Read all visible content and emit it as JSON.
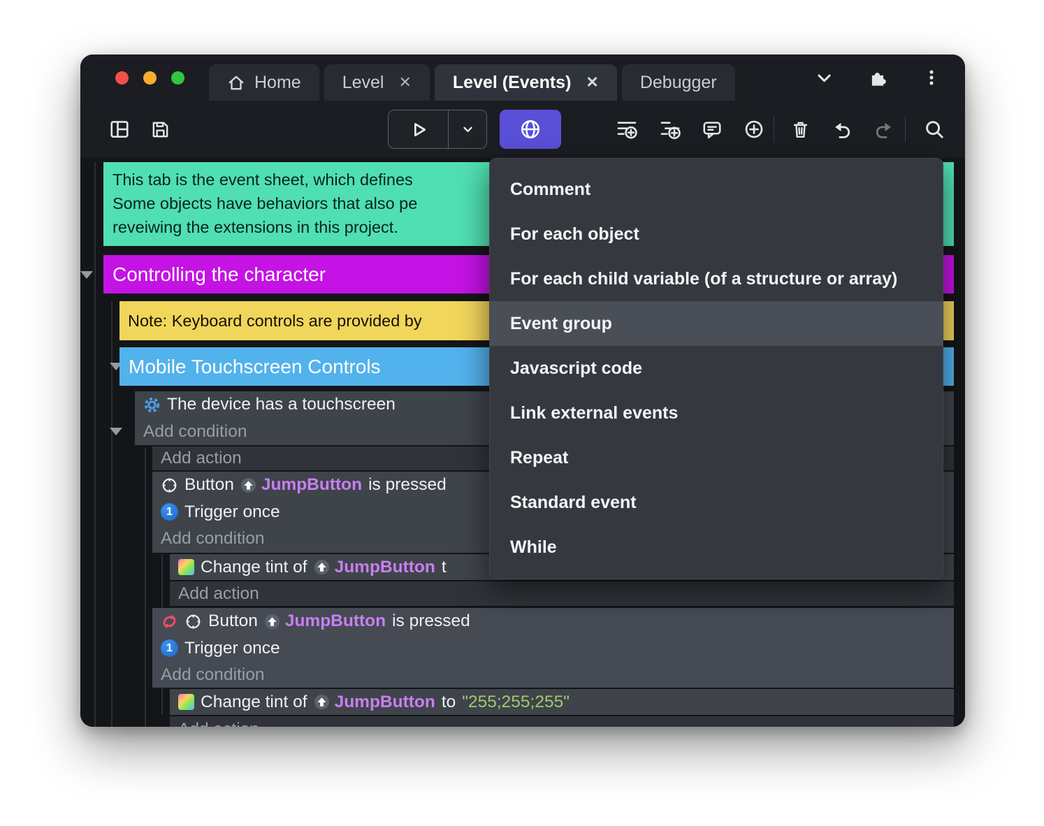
{
  "titlebar": {
    "tabs": [
      {
        "label": "Home"
      },
      {
        "label": "Level",
        "close_glyph": "✕"
      },
      {
        "label": "Level (Events)",
        "close_glyph": "✕"
      },
      {
        "label": "Debugger"
      }
    ],
    "right_icons": [
      "chevron-down",
      "puzzle-extension",
      "kebab-menu"
    ]
  },
  "toolbar": {
    "icons": [
      "layout-panels",
      "save",
      "play",
      "play-dropdown",
      "globe-add",
      "add-event",
      "add-subevent",
      "add-comment",
      "add-object",
      "delete",
      "undo",
      "redo",
      "search"
    ]
  },
  "sheet": {
    "comment_lines": {
      "line1": "This tab is the event sheet, which defines",
      "line2": "Some objects have behaviors that also pe",
      "line3": "reveiwing the extensions in this project."
    },
    "group_controlling": "Controlling the character",
    "note": "Note: Keyboard controls are provided by",
    "group_mobile": "Mobile Touchscreen Controls",
    "touch_condition": "The device has a touchscreen",
    "add_condition": "Add condition",
    "add_action": "Add action",
    "button_plugin": "Button",
    "jump_object": "JumpButton",
    "is_pressed": "is pressed",
    "trigger_once": "Trigger once",
    "trigger_digit": "1",
    "change_tint_prefix": "Change tint of",
    "tint_cut_suffix": "t",
    "to_word": "to",
    "tint_value": "\"255;255;255\""
  },
  "context_menu": {
    "items": [
      "Comment",
      "For each object",
      "For each child variable (of a structure or array)",
      "Event group",
      "Javascript code",
      "Link external events",
      "Repeat",
      "Standard event",
      "While"
    ],
    "highlighted_item": "Event group"
  },
  "colors": {
    "accent_purple_button": "#5a50d8",
    "comment_green": "#50dfb2",
    "group_magenta": "#c413e4",
    "note_yellow": "#f1d65c",
    "group_blue": "#52b2ec",
    "object_name_violet": "#c87ff0",
    "string_green": "#a3c96a",
    "menu_highlight": "#4a4f57"
  }
}
